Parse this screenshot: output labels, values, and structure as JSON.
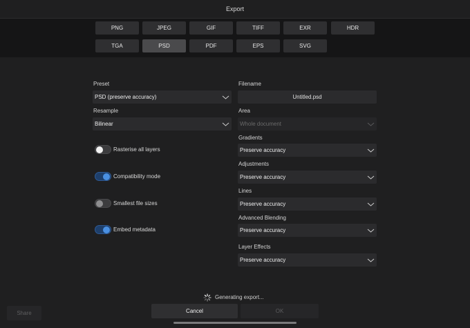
{
  "window": {
    "title": "Export"
  },
  "formats": {
    "row1": [
      "PNG",
      "JPEG",
      "GIF",
      "TIFF",
      "EXR",
      "HDR"
    ],
    "row2": [
      "TGA",
      "PSD",
      "PDF",
      "EPS",
      "SVG"
    ],
    "selected": "PSD"
  },
  "left": {
    "preset_label": "Preset",
    "preset_value": "PSD (preserve accuracy)",
    "resample_label": "Resample",
    "resample_value": "Bilinear",
    "toggles": [
      {
        "label": "Rasterise all layers",
        "state": "off"
      },
      {
        "label": "Compatibility mode",
        "state": "on"
      },
      {
        "label": "Smallest file sizes",
        "state": "off-disabled"
      },
      {
        "label": "Embed metadata",
        "state": "on"
      }
    ]
  },
  "right": {
    "filename_label": "Filename",
    "filename_value": "Untitled.psd",
    "area_label": "Area",
    "area_value": "Whole document",
    "gradients_label": "Gradients",
    "gradients_value": "Preserve accuracy",
    "adjustments_label": "Adjustments",
    "adjustments_value": "Preserve accuracy",
    "lines_label": "Lines",
    "lines_value": "Preserve accuracy",
    "advanced_blending_label": "Advanced Blending",
    "advanced_blending_value": "Preserve accuracy",
    "layer_effects_label": "Layer Effects",
    "layer_effects_value": "Preserve accuracy"
  },
  "footer": {
    "status": "Generating export...",
    "share_label": "Share",
    "cancel_label": "Cancel",
    "ok_label": "OK"
  },
  "colors": {
    "accent": "#4a90e2",
    "toggle_on_track": "#1e3f6b",
    "background": "#1f1f20"
  }
}
